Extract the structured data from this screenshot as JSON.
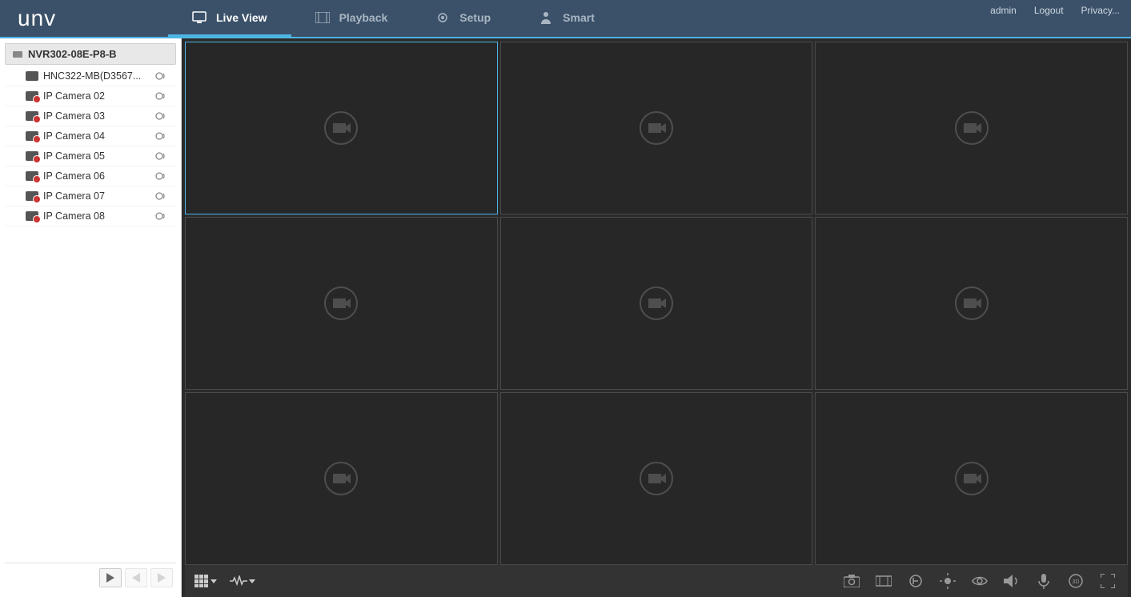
{
  "brand": "unv",
  "nav": [
    {
      "id": "liveview",
      "label": "Live View",
      "icon": "monitor-icon",
      "active": true
    },
    {
      "id": "playback",
      "label": "Playback",
      "icon": "film-icon",
      "active": false
    },
    {
      "id": "setup",
      "label": "Setup",
      "icon": "gear-icon",
      "active": false
    },
    {
      "id": "smart",
      "label": "Smart",
      "icon": "person-icon",
      "active": false
    }
  ],
  "user_links": {
    "user": "admin",
    "logout": "Logout",
    "privacy": "Privacy..."
  },
  "device_name": "NVR302-08E-P8-B",
  "cameras": [
    {
      "label": "HNC322-MB(D3567...",
      "online": true
    },
    {
      "label": "IP Camera 02",
      "online": false
    },
    {
      "label": "IP Camera 03",
      "online": false
    },
    {
      "label": "IP Camera 04",
      "online": false
    },
    {
      "label": "IP Camera 05",
      "online": false
    },
    {
      "label": "IP Camera 06",
      "online": false
    },
    {
      "label": "IP Camera 07",
      "online": false
    },
    {
      "label": "IP Camera 08",
      "online": false
    }
  ],
  "grid": {
    "rows": 3,
    "cols": 3,
    "selected_index": 0
  },
  "bottombar_icons": [
    {
      "name": "snapshot-icon"
    },
    {
      "name": "record-icon"
    },
    {
      "name": "talk-icon"
    },
    {
      "name": "brightness-icon"
    },
    {
      "name": "fisheye-icon"
    },
    {
      "name": "volume-icon"
    },
    {
      "name": "mic-icon"
    },
    {
      "name": "3d-position-icon"
    },
    {
      "name": "fullscreen-icon"
    }
  ]
}
